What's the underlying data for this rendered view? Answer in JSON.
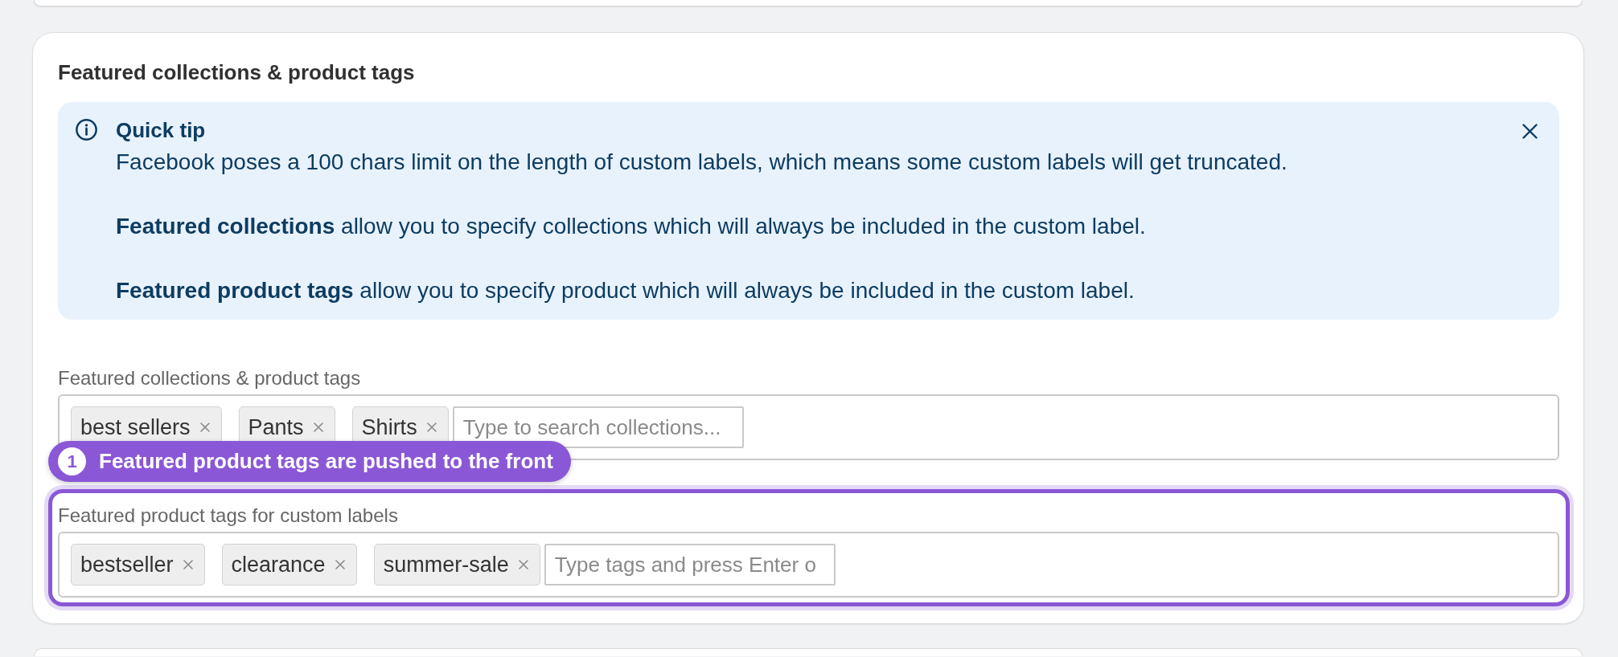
{
  "section": {
    "title": "Featured collections & product tags",
    "tip": {
      "title": "Quick tip",
      "paragraphs": [
        "Facebook poses a 100 chars limit on the length of custom labels, which means some custom labels will get truncated.",
        "**Featured collections** allow you to specify collections which will always be included in the custom label.",
        "**Featured product tags** allow you to specify product which will always be included in the custom label."
      ]
    },
    "fields": [
      {
        "label": "Featured collections & product tags",
        "tags": [
          "best sellers",
          "Pants",
          "Shirts"
        ],
        "placeholder": "Type to search collections...",
        "highlighted": false
      },
      {
        "label": "Featured product tags for custom labels",
        "tags": [
          "bestseller",
          "clearance",
          "summer-sale"
        ],
        "placeholder": "Type tags and press Enter o",
        "highlighted": true,
        "callout": {
          "number": "1",
          "text": "Featured product tags are pushed to the front"
        }
      }
    ]
  }
}
